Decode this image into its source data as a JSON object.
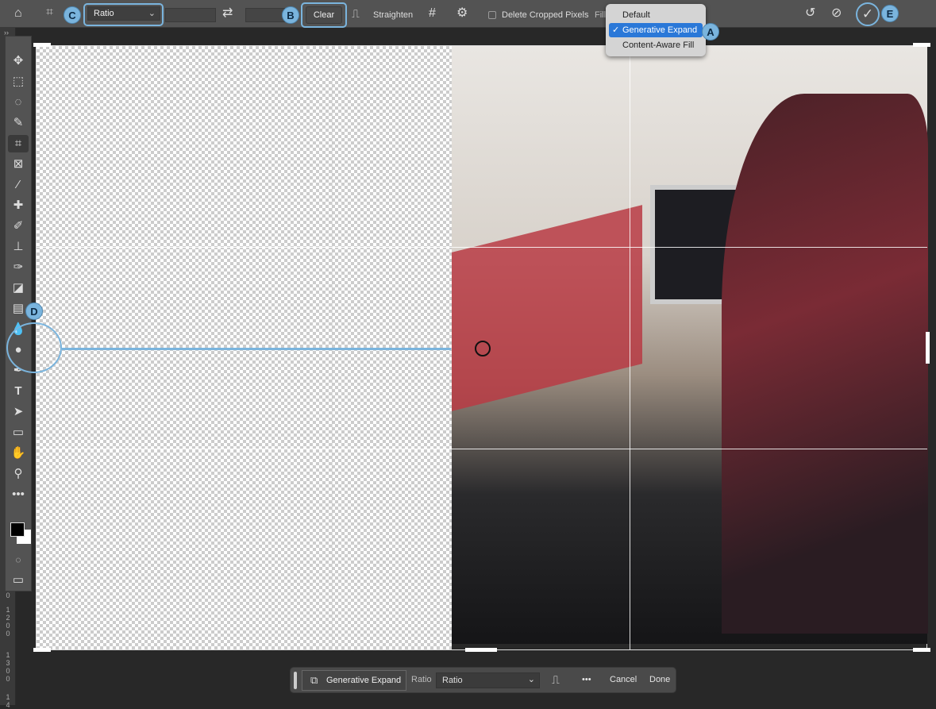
{
  "options_bar": {
    "ratio_select": "Ratio",
    "clear_label": "Clear",
    "straighten_label": "Straighten",
    "delete_cropped_label": "Delete Cropped Pixels",
    "delete_cropped_checked": false,
    "fill_label": "Fill",
    "fill_menu": {
      "items": [
        "Default",
        "Generative Expand",
        "Content-Aware Fill"
      ],
      "selected": "Generative Expand",
      "check": "✓"
    }
  },
  "callouts": {
    "a": "A",
    "b": "B",
    "c": "C",
    "d": "D",
    "e": "E"
  },
  "toolbar": {
    "collapse": "››",
    "tools": [
      "move",
      "marquee",
      "lasso",
      "quick-selection",
      "crop",
      "frame",
      "eyedropper",
      "healing-brush",
      "brush",
      "clone-stamp",
      "history-brush",
      "eraser",
      "gradient",
      "blur",
      "dodge",
      "pen",
      "type",
      "path-selection",
      "rectangle",
      "hand",
      "zoom",
      "more"
    ]
  },
  "ruler": {
    "labels": [
      "0",
      "1200",
      "1300",
      "14"
    ]
  },
  "taskbar": {
    "generative_expand": "Generative Expand",
    "ratio_label": "Ratio",
    "ratio_value": "Ratio",
    "more": "•••",
    "cancel": "Cancel",
    "done": "Done"
  },
  "colors": {
    "accent": "#7ab4dd",
    "menu_selected": "#2a78d8",
    "foreground": "#000000",
    "background": "#ffffff"
  }
}
